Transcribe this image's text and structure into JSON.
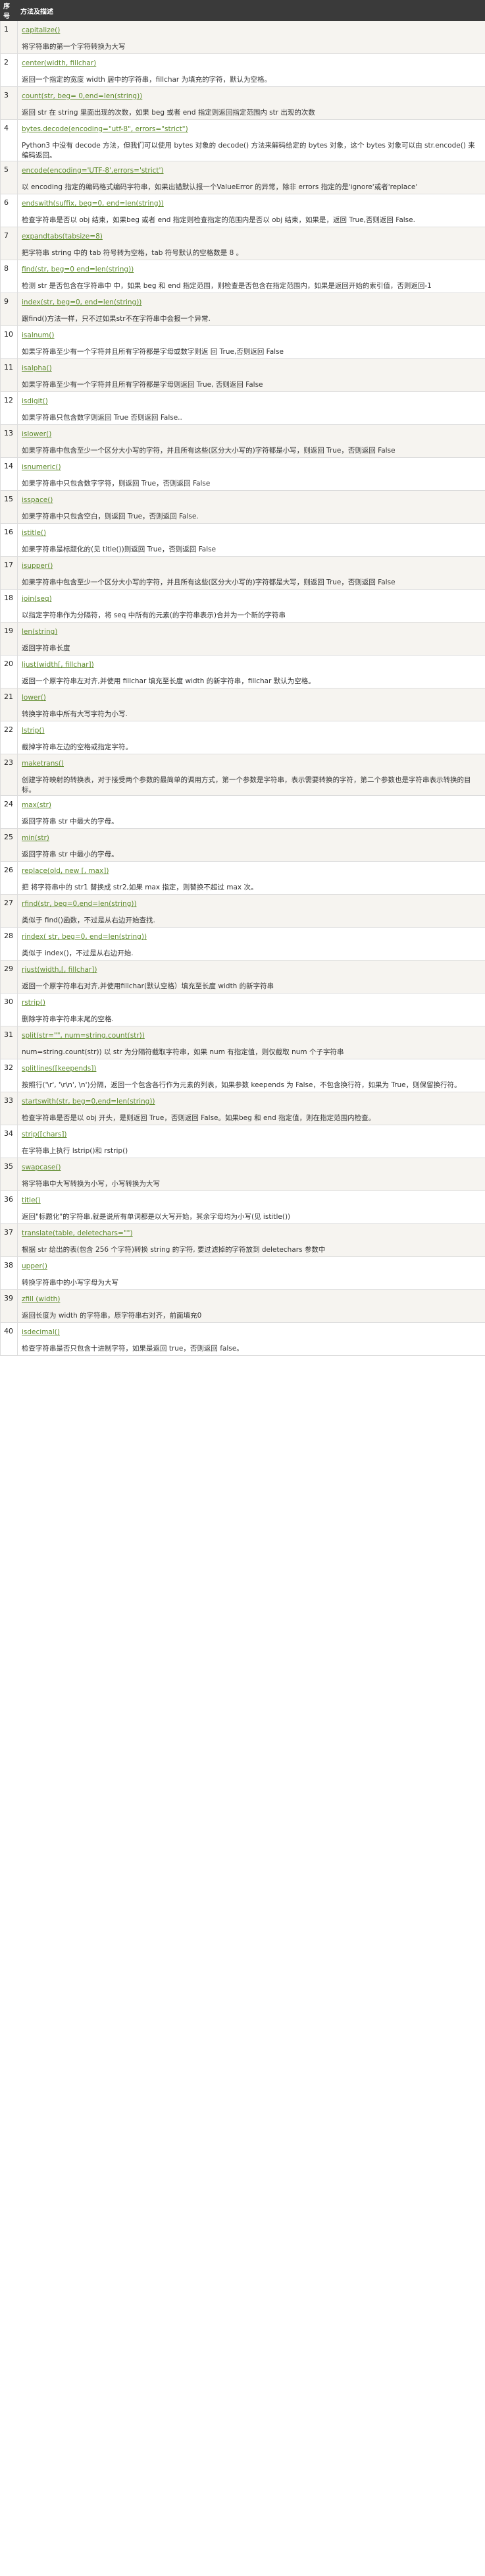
{
  "table": {
    "header": {
      "index": "序号",
      "description": "方法及描述"
    },
    "rows": [
      {
        "index": "1",
        "method": "capitalize()",
        "desc": "将字符串的第一个字符转换为大写"
      },
      {
        "index": "2",
        "method": "center(width, fillchar)",
        "desc": "返回一个指定的宽度 width 居中的字符串，fillchar 为填充的字符，默认为空格。"
      },
      {
        "index": "3",
        "method": "count(str, beg= 0,end=len(string))",
        "desc": "返回 str 在 string 里面出现的次数，如果 beg 或者 end 指定则返回指定范围内 str 出现的次数"
      },
      {
        "index": "4",
        "method": "bytes.decode(encoding=\"utf-8\", errors=\"strict\")",
        "desc": "Python3 中没有 decode 方法，但我们可以使用 bytes 对象的 decode() 方法来解码给定的 bytes 对象，这个 bytes 对象可以由 str.encode() 来编码返回。"
      },
      {
        "index": "5",
        "method": "encode(encoding='UTF-8',errors='strict')",
        "desc": "以 encoding 指定的编码格式编码字符串，如果出错默认报一个ValueError 的异常，除非 errors 指定的是'ignore'或者'replace'"
      },
      {
        "index": "6",
        "method": "endswith(suffix, beg=0, end=len(string))",
        "desc": "检查字符串是否以 obj 结束，如果beg 或者 end 指定则检查指定的范围内是否以 obj 结束，如果是，返回 True,否则返回 False."
      },
      {
        "index": "7",
        "method": "expandtabs(tabsize=8)",
        "desc": "把字符串 string 中的 tab 符号转为空格，tab 符号默认的空格数是 8 。"
      },
      {
        "index": "8",
        "method": "find(str, beg=0 end=len(string))",
        "desc": "检测 str 是否包含在字符串中 中，如果 beg 和 end 指定范围，则检查是否包含在指定范围内，如果是返回开始的索引值，否则返回-1"
      },
      {
        "index": "9",
        "method": "index(str, beg=0, end=len(string))",
        "desc": "跟find()方法一样，只不过如果str不在字符串中会报一个异常."
      },
      {
        "index": "10",
        "method": "isalnum()",
        "desc": "如果字符串至少有一个字符并且所有字符都是字母或数字则返 回 True,否则返回 False"
      },
      {
        "index": "11",
        "method": "isalpha()",
        "desc": "如果字符串至少有一个字符并且所有字符都是字母则返回 True, 否则返回 False"
      },
      {
        "index": "12",
        "method": "isdigit()",
        "desc": "如果字符串只包含数字则返回 True 否则返回 False.."
      },
      {
        "index": "13",
        "method": "islower()",
        "desc": "如果字符串中包含至少一个区分大小写的字符，并且所有这些(区分大小写的)字符都是小写，则返回 True，否则返回 False"
      },
      {
        "index": "14",
        "method": "isnumeric()",
        "desc": "如果字符串中只包含数字字符，则返回 True，否则返回 False"
      },
      {
        "index": "15",
        "method": "isspace()",
        "desc": "如果字符串中只包含空白，则返回 True，否则返回 False."
      },
      {
        "index": "16",
        "method": "istitle()",
        "desc": "如果字符串是标题化的(见 title())则返回 True，否则返回 False"
      },
      {
        "index": "17",
        "method": "isupper()",
        "desc": "如果字符串中包含至少一个区分大小写的字符，并且所有这些(区分大小写的)字符都是大写，则返回 True，否则返回 False"
      },
      {
        "index": "18",
        "method": "join(seq)",
        "desc": "以指定字符串作为分隔符，将 seq 中所有的元素(的字符串表示)合并为一个新的字符串"
      },
      {
        "index": "19",
        "method": "len(string)",
        "desc": "返回字符串长度"
      },
      {
        "index": "20",
        "method": "ljust(width[, fillchar])",
        "desc": "返回一个原字符串左对齐,并使用 fillchar 填充至长度 width 的新字符串，fillchar 默认为空格。"
      },
      {
        "index": "21",
        "method": "lower()",
        "desc": "转换字符串中所有大写字符为小写."
      },
      {
        "index": "22",
        "method": "lstrip()",
        "desc": "截掉字符串左边的空格或指定字符。"
      },
      {
        "index": "23",
        "method": "maketrans()",
        "desc": "创建字符映射的转换表，对于接受两个参数的最简单的调用方式，第一个参数是字符串，表示需要转换的字符，第二个参数也是字符串表示转换的目标。"
      },
      {
        "index": "24",
        "method": "max(str)",
        "desc": "返回字符串 str 中最大的字母。"
      },
      {
        "index": "25",
        "method": "min(str)",
        "desc": "返回字符串 str 中最小的字母。"
      },
      {
        "index": "26",
        "method": "replace(old, new [, max])",
        "desc": "把 将字符串中的 str1 替换成 str2,如果 max 指定，则替换不超过 max 次。"
      },
      {
        "index": "27",
        "method": "rfind(str, beg=0,end=len(string))",
        "desc": "类似于 find()函数，不过是从右边开始查找."
      },
      {
        "index": "28",
        "method": "rindex( str, beg=0, end=len(string))",
        "desc": "类似于 index()，不过是从右边开始."
      },
      {
        "index": "29",
        "method": "rjust(width,[, fillchar])",
        "desc": "返回一个原字符串右对齐,并使用fillchar(默认空格）填充至长度 width 的新字符串"
      },
      {
        "index": "30",
        "method": "rstrip()",
        "desc": "删除字符串字符串末尾的空格."
      },
      {
        "index": "31",
        "method": "split(str=\"\", num=string.count(str))",
        "desc": "num=string.count(str)) 以 str 为分隔符截取字符串，如果 num 有指定值，则仅截取 num 个子字符串"
      },
      {
        "index": "32",
        "method": "splitlines([keepends])",
        "desc": "按照行('\\r', '\\r\\n', \\n')分隔，返回一个包含各行作为元素的列表，如果参数 keepends 为 False，不包含换行符，如果为 True，则保留换行符。"
      },
      {
        "index": "33",
        "method": "startswith(str, beg=0,end=len(string))",
        "desc": "检查字符串是否是以 obj 开头，是则返回 True，否则返回 False。如果beg 和 end 指定值，则在指定范围内检查。"
      },
      {
        "index": "34",
        "method": "strip([chars])",
        "desc": "在字符串上执行 lstrip()和 rstrip()"
      },
      {
        "index": "35",
        "method": "swapcase()",
        "desc": "将字符串中大写转换为小写，小写转换为大写"
      },
      {
        "index": "36",
        "method": "title()",
        "desc": "返回\"标题化\"的字符串,就是说所有单词都是以大写开始，其余字母均为小写(见 istitle())"
      },
      {
        "index": "37",
        "method": "translate(table, deletechars=\"\")",
        "desc": "根据 str 给出的表(包含 256 个字符)转换 string 的字符, 要过滤掉的字符放到 deletechars 参数中"
      },
      {
        "index": "38",
        "method": "upper()",
        "desc": "转换字符串中的小写字母为大写"
      },
      {
        "index": "39",
        "method": "zfill (width)",
        "desc": "返回长度为 width 的字符串，原字符串右对齐，前面填充0"
      },
      {
        "index": "40",
        "method": "isdecimal()",
        "desc": "检查字符串是否只包含十进制字符，如果是返回 true，否则返回 false。"
      }
    ]
  }
}
